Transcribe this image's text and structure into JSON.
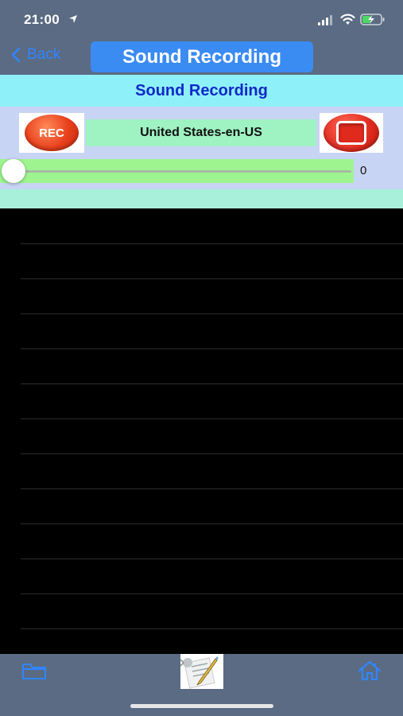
{
  "status_bar": {
    "time": "21:00"
  },
  "nav": {
    "back_label": "Back",
    "title": "Sound Recording"
  },
  "banner": {
    "title": "Sound Recording"
  },
  "controls": {
    "rec_label": "REC",
    "language": "United States-en-US",
    "slider_value": "0",
    "slider_fraction": 0
  },
  "notes": {
    "line_count": 13
  },
  "tabbar": {
    "left_icon": "folder-icon",
    "center_icon": "edit-document-icon",
    "right_icon": "home-icon"
  },
  "colors": {
    "header_bg": "#5a6b83",
    "nav_accent": "#2f86ff",
    "title_bg": "#3a8bf2",
    "banner_bg": "#8ef0f9",
    "banner_text": "#1028c8",
    "controls_bg": "#c8d4f3",
    "slider_bg": "#9ef590",
    "teal_strip": "#a8f0da",
    "record_red": "#e8401c"
  }
}
